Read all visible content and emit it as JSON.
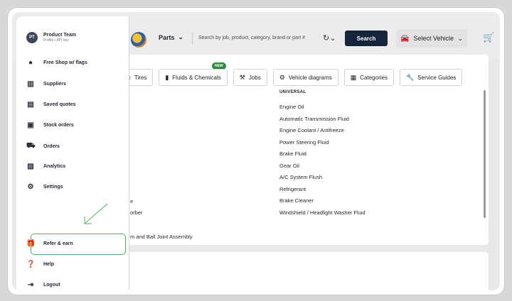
{
  "profile": {
    "initials": "PT",
    "name": "Product Team",
    "subtitle": "Profile • API key"
  },
  "menu": [
    {
      "label": "Free Shop w/ flags",
      "icon": "location-pin-icon"
    },
    {
      "label": "Suppliers",
      "icon": "building-icon"
    },
    {
      "label": "Saved quotes",
      "icon": "document-icon"
    },
    {
      "label": "Stock orders",
      "icon": "stock-icon"
    },
    {
      "label": "Orders",
      "icon": "cart-icon"
    },
    {
      "label": "Analytics",
      "icon": "analytics-icon"
    },
    {
      "label": "Settings",
      "icon": "gear-icon"
    }
  ],
  "refer": {
    "label": "Refer & earn",
    "icon": "gift-icon"
  },
  "bottom_menu": [
    {
      "label": "Help",
      "icon": "help-icon"
    },
    {
      "label": "Logout",
      "icon": "logout-icon"
    }
  ],
  "header": {
    "parts_label": "Parts",
    "search_placeholder": "Search by job, product, category, brand or part #",
    "search_button": "Search",
    "vehicle_label": "Select Vehicle"
  },
  "tabs": [
    {
      "label": "Tires"
    },
    {
      "label": "Fluids & Chemicals"
    },
    {
      "label": "Jobs"
    },
    {
      "label": "Vehicle diagrams"
    },
    {
      "label": "Categories"
    },
    {
      "label": "Service Guides"
    }
  ],
  "new_badge": "NEW",
  "category": {
    "title": "UNIVERSAL",
    "items": [
      "Engine Oil",
      "Automatic Transmission Fluid",
      "Engine Coolant / Antifreeze",
      "Power Steering Fluid",
      "Brake Fluid",
      "Gear Oil",
      "A/C System Flush",
      "Refrigerant",
      "Brake Cleaner",
      "Windshield / Headlight Washer Fluid"
    ]
  },
  "peek_text": [
    "e",
    "orber",
    "m and Ball Joint Assembly"
  ],
  "colors": {
    "accent": "#15233b",
    "highlight": "#4fb364",
    "badge": "#2c8a3c"
  }
}
